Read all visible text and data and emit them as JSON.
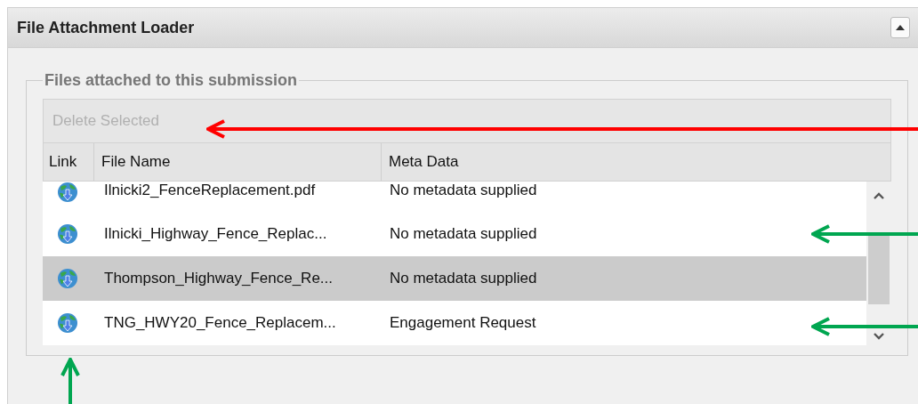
{
  "panel": {
    "title": "File Attachment Loader",
    "collapsed": false
  },
  "fieldset": {
    "legend": "Files attached to this submission"
  },
  "toolbar": {
    "buttons": [
      {
        "label": "Delete Selected",
        "disabled": true
      }
    ]
  },
  "table": {
    "columns": [
      "Link",
      "File Name",
      "Meta Data"
    ],
    "rows": [
      {
        "file_name": "Ilnicki2_FenceReplacement.pdf",
        "meta_data": "No metadata supplied",
        "selected": false
      },
      {
        "file_name": "Ilnicki_Highway_Fence_Replac...",
        "meta_data": "No metadata supplied",
        "selected": false
      },
      {
        "file_name": "Thompson_Highway_Fence_Re...",
        "meta_data": "No metadata supplied",
        "selected": true
      },
      {
        "file_name": "TNG_HWY20_Fence_Replacem...",
        "meta_data": "Engagement Request",
        "selected": false
      }
    ]
  },
  "annotation_arrows": [
    {
      "kind": "left",
      "color": "#ff0000"
    },
    {
      "kind": "left",
      "color": "#00a650"
    },
    {
      "kind": "left",
      "color": "#00a650"
    },
    {
      "kind": "up",
      "color": "#00a650"
    }
  ]
}
